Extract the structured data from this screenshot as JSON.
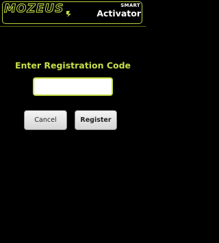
{
  "header": {
    "logo_text": "MOZEUS",
    "logo_mark": "lightning-bolt",
    "brand_small": "SMART",
    "brand_title": "Activator"
  },
  "main": {
    "prompt": "Enter Registration Code",
    "code_input": {
      "value": "",
      "placeholder": ""
    },
    "cancel_label": "Cancel",
    "register_label": "Register"
  },
  "colors": {
    "background": "#000000",
    "accent": "#c6e04a",
    "button_bg": "#e6e6e6",
    "text_light": "#ffffff"
  }
}
